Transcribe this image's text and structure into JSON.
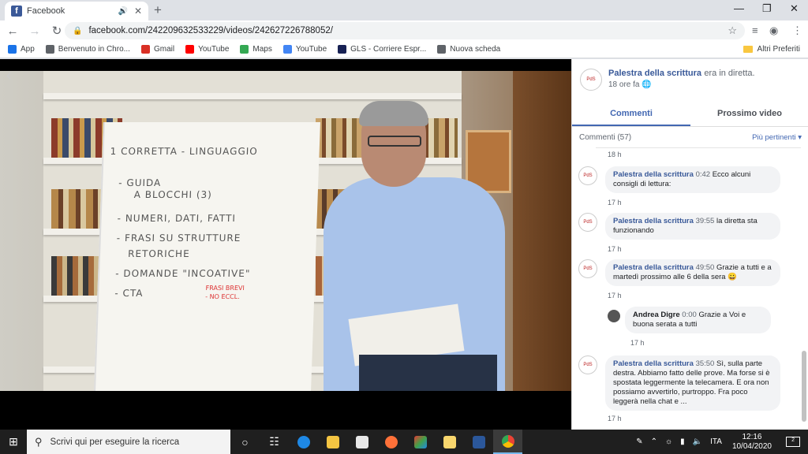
{
  "browser": {
    "tab_title": "Facebook",
    "tab_favicon": "f",
    "url": "facebook.com/242209632533229/videos/242627226788052/",
    "bookmarks": [
      {
        "label": "App",
        "icon": "apps-grid-icon",
        "color": "#1a73e8"
      },
      {
        "label": "Benvenuto in Chro...",
        "icon": "globe-icon",
        "color": "#5f6368"
      },
      {
        "label": "Gmail",
        "icon": "gmail-icon",
        "color": "#d93025"
      },
      {
        "label": "YouTube",
        "icon": "youtube-icon",
        "color": "#ff0000"
      },
      {
        "label": "Maps",
        "icon": "maps-icon",
        "color": "#34a853"
      },
      {
        "label": "YouTube",
        "icon": "google-icon",
        "color": "#4285f4"
      },
      {
        "label": "GLS - Corriere Espr...",
        "icon": "gls-icon",
        "color": "#172154"
      },
      {
        "label": "Nuova scheda",
        "icon": "globe-icon",
        "color": "#5f6368"
      }
    ],
    "other_bookmarks": "Altri Preferiti"
  },
  "video": {
    "flipchart_lines": [
      "1 CORRETTA - LINGUAGGIO",
      "- GUIDA",
      "  A BLOCCHI (3)",
      "- NUMERI, DATI, FATTI",
      "- FRASI SU STRUTTURE",
      "  RETORICHE",
      "- DOMANDE \"INCOATIVE\"",
      "- CTA"
    ],
    "flipchart_red": [
      "FRASI BREVI",
      "- NO ECCL."
    ]
  },
  "panel": {
    "page_name": "Palestra della scrittura",
    "live_text": "era in diretta.",
    "time_meta": "18 ore fa",
    "tabs": [
      "Commenti",
      "Prossimo video"
    ],
    "comments_count": "Commenti (57)",
    "relevance": "Più pertinenti",
    "top_time": "18 h",
    "comments": [
      {
        "author": "Palestra della scrittura",
        "ts": "0:42",
        "text": "Ecco alcuni consigli di lettura:",
        "time": "17 h"
      },
      {
        "author": "Palestra della scrittura",
        "ts": "39:55",
        "text": "la diretta sta funzionando",
        "time": "17 h"
      },
      {
        "author": "Palestra della scrittura",
        "ts": "49:50",
        "text": "Grazie a tutti e a martedì prossimo alle 6 della sera 😀",
        "time": "17 h"
      },
      {
        "author": "Andrea Digre",
        "ts": "0:00",
        "text": "Grazie a Voi e buona serata a tutti",
        "time": "17 h"
      },
      {
        "author": "Palestra della scrittura",
        "ts": "35:50",
        "text": "Sì, sulla parte destra. Abbiamo fatto delle prove. Ma forse si è spostata leggermente la telecamera. E ora non possiamo avvertirlo, purtroppo. Fra poco leggerà nella chat e ...",
        "time": "17 h"
      }
    ]
  },
  "taskbar": {
    "search_placeholder": "Scrivi qui per eseguire la ricerca",
    "lang": "ITA",
    "time": "12:16",
    "date": "10/04/2020",
    "notif_count": "2"
  }
}
